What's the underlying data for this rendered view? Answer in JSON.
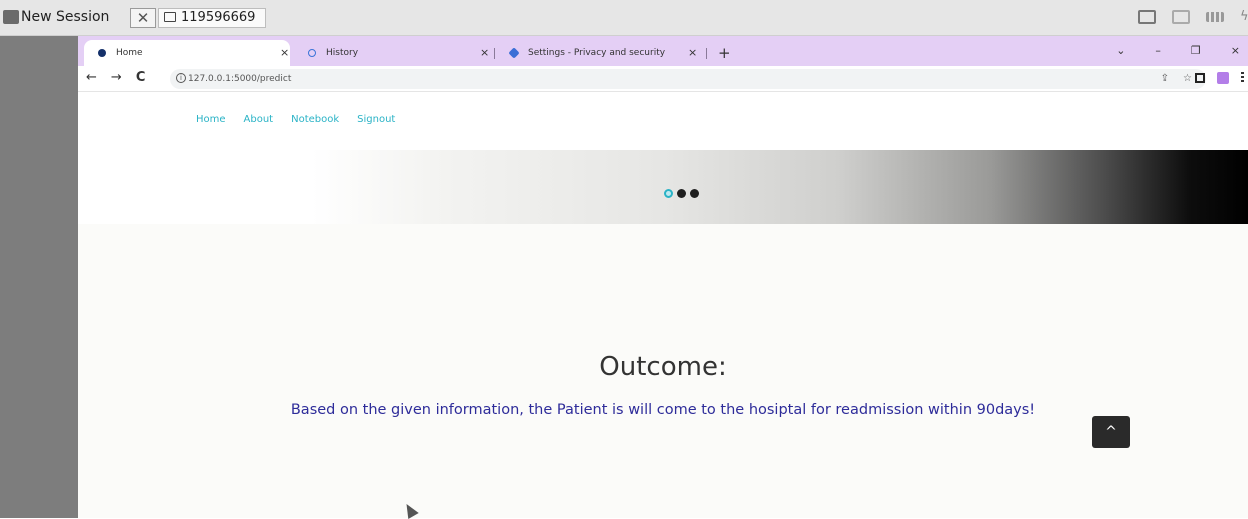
{
  "remote": {
    "app_label": "New Session",
    "close_glyph": "✕",
    "session_id": "119596669"
  },
  "browser": {
    "tabs": [
      {
        "title": "Home",
        "icon": "site-icon",
        "close": "×"
      },
      {
        "title": "History",
        "icon": "history-icon",
        "close": "×"
      },
      {
        "title": "Settings - Privacy and security",
        "icon": "gear-icon",
        "close": "×"
      }
    ],
    "new_tab_glyph": "+",
    "window_controls": {
      "dropdown": "⌄",
      "minimize": "–",
      "restore": "❐",
      "close": "×"
    },
    "nav": {
      "back": "←",
      "forward": "→",
      "reload": "C"
    },
    "url": "127.0.0.1:5000/predict",
    "info_glyph": "i",
    "share_glyph": "⇪",
    "star_glyph": "☆"
  },
  "site": {
    "nav_links": [
      "Home",
      "About",
      "Notebook",
      "Signout"
    ],
    "carousel": {
      "slide_count": 3,
      "active_index": 0
    },
    "outcome_title": "Outcome:",
    "outcome_text": "Based on the given information, the Patient is will come to the hosiptal for readmission within 90days!",
    "back_to_top_glyph": "^"
  },
  "colors": {
    "tab_bar": "#e4cff5",
    "link": "#2ab3c6",
    "outcome_text": "#2e2c9a",
    "side_margin": "#7d7d7d"
  }
}
